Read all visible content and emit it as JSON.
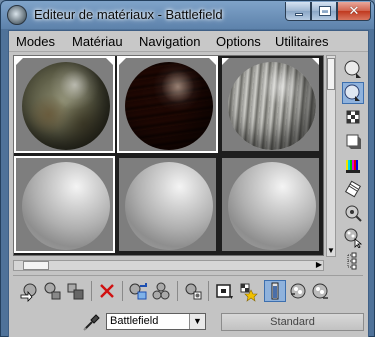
{
  "window": {
    "title": "Editeur de matériaux - Battlefield",
    "min_glyph": "",
    "max_glyph": "",
    "close_glyph": "✕"
  },
  "menu": {
    "items": [
      "Modes",
      "Matériau",
      "Navigation",
      "Options",
      "Utilitaires"
    ]
  },
  "slots": [
    {
      "kind": "textured-stone",
      "active": true
    },
    {
      "kind": "textured-wood",
      "active": true
    },
    {
      "kind": "textured-metal",
      "active": false
    },
    {
      "kind": "default-gray",
      "active": false
    },
    {
      "kind": "default-gray",
      "active": false
    },
    {
      "kind": "default-gray",
      "active": false
    }
  ],
  "side_toolbar": [
    {
      "icon": "sample-type-sphere-icon",
      "active": false
    },
    {
      "icon": "backlight-icon",
      "active": true
    },
    {
      "icon": "checker-background-icon",
      "active": false
    },
    {
      "icon": "sample-uv-tiling-icon",
      "active": false
    },
    {
      "icon": "video-color-check-icon",
      "active": false
    },
    {
      "icon": "make-preview-icon",
      "active": false
    },
    {
      "icon": "options-icon",
      "active": false
    },
    {
      "icon": "select-by-material-icon",
      "active": false
    },
    {
      "icon": "material-map-navigator-icon",
      "active": false
    }
  ],
  "bottom_toolbar": [
    {
      "icon": "get-material-icon",
      "active": false
    },
    {
      "icon": "put-material-to-scene-icon",
      "active": false
    },
    {
      "icon": "assign-material-to-selection-icon",
      "active": false
    },
    {
      "icon": "reset-map-icon",
      "active": false
    },
    {
      "icon": "make-material-copy-icon",
      "active": false
    },
    {
      "icon": "make-unique-icon",
      "active": false
    },
    {
      "icon": "put-to-library-icon",
      "active": false
    },
    {
      "icon": "material-id-channel-icon",
      "active": false
    },
    {
      "icon": "show-map-in-viewport-icon",
      "active": false
    },
    {
      "icon": "show-end-result-icon",
      "active": true
    },
    {
      "icon": "go-to-parent-icon",
      "active": false
    },
    {
      "icon": "go-forward-to-sibling-icon",
      "active": false
    }
  ],
  "material": {
    "name": "Battlefield",
    "dropdown_glyph": "▼",
    "type_label": "Standard"
  },
  "scroll": {
    "up": "▲",
    "down": "▼",
    "left": "◀",
    "right": "▶"
  }
}
